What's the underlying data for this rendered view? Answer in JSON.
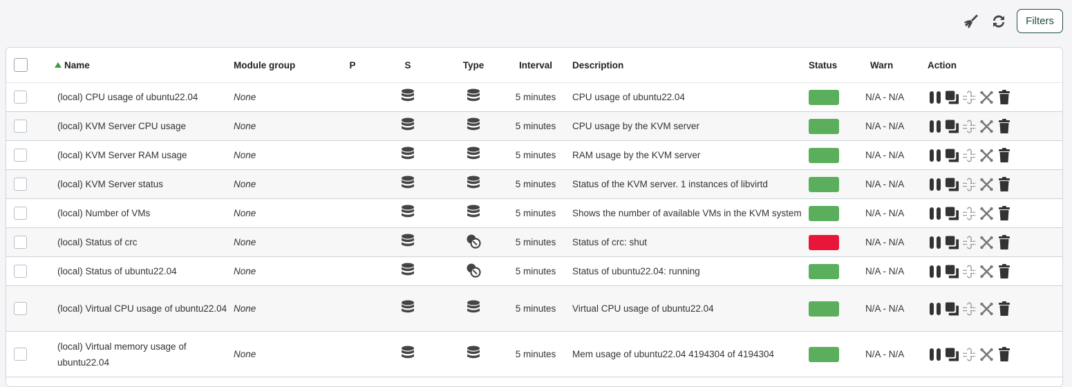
{
  "toolbar": {
    "clean_icon": "broom-icon",
    "refresh_icon": "refresh-icon",
    "filters_label": "Filters"
  },
  "table": {
    "headers": {
      "name": "Name",
      "module_group": "Module group",
      "p": "P",
      "s": "S",
      "type": "Type",
      "interval": "Interval",
      "description": "Description",
      "status": "Status",
      "warn": "Warn",
      "action": "Action"
    },
    "sort": {
      "column": "Name",
      "direction": "ascending"
    },
    "colors": {
      "status_ok": "#5aae5c",
      "status_critical": "#e8173a",
      "sort_arrow": "#3b9d45"
    },
    "rows": [
      {
        "name": "(local) CPU usage of ubuntu22.04",
        "group": "None",
        "type_icon": "database-icon",
        "interval": "5 minutes",
        "description": "CPU usage of ubuntu22.04",
        "status": "ok",
        "warn": "N/A - N/A"
      },
      {
        "name": "(local) KVM Server CPU usage",
        "group": "None",
        "type_icon": "database-icon",
        "interval": "5 minutes",
        "description": "CPU usage by the KVM server",
        "status": "ok",
        "warn": "N/A - N/A"
      },
      {
        "name": "(local) KVM Server RAM usage",
        "group": "None",
        "type_icon": "database-icon",
        "interval": "5 minutes",
        "description": "RAM usage by the KVM server",
        "status": "ok",
        "warn": "N/A - N/A"
      },
      {
        "name": "(local) KVM Server status",
        "group": "None",
        "type_icon": "database-icon",
        "interval": "5 minutes",
        "description": "Status of the KVM server. 1 instances of libvirtd",
        "status": "ok",
        "warn": "N/A - N/A"
      },
      {
        "name": "(local) Number of VMs",
        "group": "None",
        "type_icon": "database-icon",
        "interval": "5 minutes",
        "description": "Shows the number of available VMs in the KVM system",
        "status": "ok",
        "warn": "N/A - N/A"
      },
      {
        "name": "(local) Status of crc",
        "group": "None",
        "type_icon": "boolean-icon",
        "interval": "5 minutes",
        "description": "Status of crc: shut",
        "status": "critical",
        "warn": "N/A - N/A"
      },
      {
        "name": "(local) Status of ubuntu22.04",
        "group": "None",
        "type_icon": "boolean-icon",
        "interval": "5 minutes",
        "description": "Status of ubuntu22.04: running",
        "status": "ok",
        "warn": "N/A - N/A"
      },
      {
        "name": "(local) Virtual CPU usage of ubuntu22.04",
        "group": "None",
        "type_icon": "database-icon",
        "interval": "5 minutes",
        "description": "Virtual CPU usage of ubuntu22.04",
        "status": "ok",
        "warn": "N/A - N/A"
      },
      {
        "name": "(local) Virtual memory usage of ubuntu22.04",
        "group": "None",
        "type_icon": "database-icon",
        "interval": "5 minutes",
        "description": "Mem usage of ubuntu22.04 4194304 of 4194304",
        "status": "ok",
        "warn": "N/A - N/A"
      }
    ],
    "action_icons": [
      "pause-icon",
      "copy-icon",
      "link-icon",
      "unlink-icon",
      "delete-icon"
    ]
  }
}
